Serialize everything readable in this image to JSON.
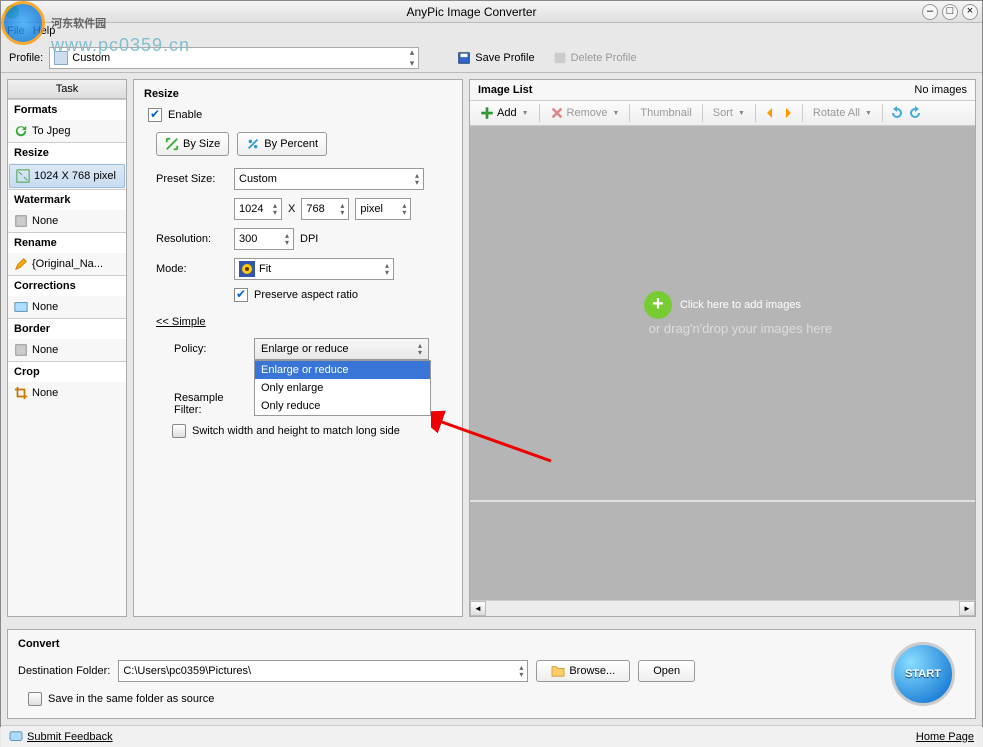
{
  "window": {
    "title": "AnyPic Image Converter"
  },
  "menubar": {
    "file": "File",
    "help": "Help"
  },
  "toolbar": {
    "profile_label": "Profile:",
    "profile_value": "Custom",
    "save_profile": "Save Profile",
    "delete_profile": "Delete Profile"
  },
  "sidebar": {
    "header": "Task",
    "groups": [
      {
        "title": "Formats",
        "item": "To Jpeg",
        "icon": "arrow-cycle"
      },
      {
        "title": "Resize",
        "item": "1024 X 768 pixel",
        "icon": "resize",
        "selected": true
      },
      {
        "title": "Watermark",
        "item": "None",
        "icon": "watermark"
      },
      {
        "title": "Rename",
        "item": "{Original_Na...",
        "icon": "pencil"
      },
      {
        "title": "Corrections",
        "item": "None",
        "icon": "picture"
      },
      {
        "title": "Border",
        "item": "None",
        "icon": "border"
      },
      {
        "title": "Crop",
        "item": "None",
        "icon": "crop"
      }
    ]
  },
  "resize": {
    "header": "Resize",
    "enable_label": "Enable",
    "by_size": "By Size",
    "by_percent": "By Percent",
    "preset_size_label": "Preset Size:",
    "preset_size_value": "Custom",
    "width": "1024",
    "x": "X",
    "height": "768",
    "unit": "pixel",
    "resolution_label": "Resolution:",
    "resolution_value": "300",
    "dpi": "DPI",
    "mode_label": "Mode:",
    "mode_value": "Fit",
    "preserve_aspect": "Preserve aspect ratio",
    "simple_link": "<< Simple",
    "policy_label": "Policy:",
    "policy_value": "Enlarge or reduce",
    "policy_options": [
      "Enlarge or reduce",
      "Only enlarge",
      "Only reduce"
    ],
    "resample_label": "Resample Filter:",
    "switch_wh": "Switch width and height to match long side"
  },
  "imagelist": {
    "header": "Image List",
    "no_images": "No images",
    "add": "Add",
    "remove": "Remove",
    "thumbnail": "Thumbnail",
    "sort": "Sort",
    "rotate_all": "Rotate All",
    "drop_main": "Click here  to add images",
    "drop_sub": "or drag'n'drop your images here"
  },
  "convert": {
    "header": "Convert",
    "dest_label": "Destination Folder:",
    "dest_value": "C:\\Users\\pc0359\\Pictures\\",
    "browse": "Browse...",
    "open": "Open",
    "same_folder": "Save in the same folder as source",
    "start": "START"
  },
  "status": {
    "feedback": "Submit Feedback",
    "homepage": "Home Page"
  },
  "overlay": {
    "wm_text": "河东软件园",
    "wm_url": "www.pc0359.cn"
  }
}
